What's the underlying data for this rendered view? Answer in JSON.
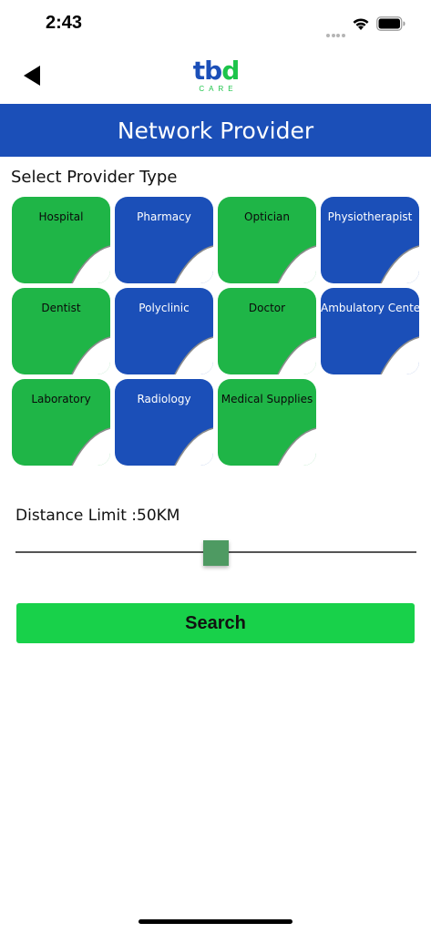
{
  "status_bar": {
    "time": "2:43",
    "icons": [
      "signal-dots-icon",
      "wifi-icon",
      "battery-icon"
    ]
  },
  "nav": {
    "back_icon": "back-arrow-icon",
    "logo_main_a": "tb",
    "logo_main_b": "d",
    "logo_sub": "CARE"
  },
  "header": {
    "title": "Network Provider"
  },
  "provider_section": {
    "label": "Select Provider Type",
    "types": [
      {
        "label": "Hospital",
        "color": "green"
      },
      {
        "label": "Pharmacy",
        "color": "blue"
      },
      {
        "label": "Optician",
        "color": "green"
      },
      {
        "label": "Physiotherapist",
        "color": "blue"
      },
      {
        "label": "Dentist",
        "color": "green"
      },
      {
        "label": "Polyclinic",
        "color": "blue"
      },
      {
        "label": "Doctor",
        "color": "green"
      },
      {
        "label": "Ambulatory Center",
        "color": "blue"
      },
      {
        "label": "Laboratory",
        "color": "green"
      },
      {
        "label": "Radiology",
        "color": "blue"
      },
      {
        "label": "Medical Supplies",
        "color": "green"
      }
    ]
  },
  "distance": {
    "label": "Distance Limit :50KM",
    "slider_fraction": 0.5
  },
  "search_button": {
    "label": "Search"
  },
  "colors": {
    "brand_blue": "#1b4fb8",
    "brand_green": "#1fb547",
    "button_green": "#18d14a",
    "slider_thumb": "#4e9a62"
  }
}
